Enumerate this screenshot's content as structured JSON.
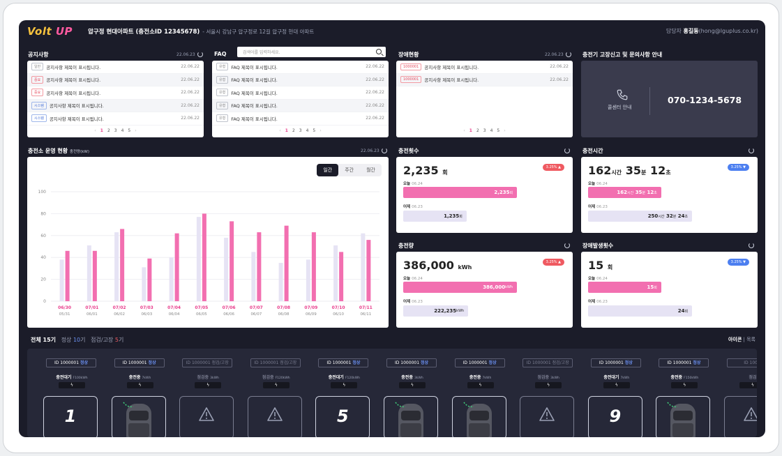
{
  "header": {
    "logo_a": "Volt",
    "logo_b": "UP",
    "site": "압구정 현대아파트 (충전소ID 12345678)",
    "address": "- 서울시 강남구 압구정로 12길 압구정 현대 아파트",
    "user_prefix": "담당자",
    "user_name": "홍길동",
    "user_email": "(hong@lguplus.co.kr)"
  },
  "notice": {
    "title": "공지사항",
    "date": "22.06.23",
    "rows": [
      {
        "badge": "일반",
        "kind": "gray",
        "title": "공지사항 제목이 표시됩니다.",
        "date": "22.06.22"
      },
      {
        "badge": "중요",
        "kind": "red",
        "title": "공지사항 제목이 표시됩니다.",
        "date": "22.06.22"
      },
      {
        "badge": "중요",
        "kind": "red",
        "title": "공지사항 제목이 표시됩니다.",
        "date": "22.06.22"
      },
      {
        "badge": "시스템",
        "kind": "blue",
        "title": "공지사항 제목이 표시됩니다.",
        "date": "22.06.22"
      },
      {
        "badge": "시스템",
        "kind": "blue",
        "title": "공지사항 제목이 표시됩니다.",
        "date": "22.06.22"
      }
    ],
    "pages": [
      "1",
      "2",
      "3",
      "4",
      "5"
    ]
  },
  "faq": {
    "title": "FAQ",
    "search_placeholder": "검색어를 입력하세요.",
    "rows": [
      {
        "badge": "유형",
        "title": "FAQ 제목이 표시됩니다.",
        "date": "22.06.22"
      },
      {
        "badge": "유형",
        "title": "FAQ 제목이 표시됩니다.",
        "date": "22.06.22"
      },
      {
        "badge": "유형",
        "title": "FAQ 제목이 표시됩니다.",
        "date": "22.06.22"
      },
      {
        "badge": "유형",
        "title": "FAQ 제목이 표시됩니다.",
        "date": "22.06.22"
      },
      {
        "badge": "유형",
        "title": "FAQ 제목이 표시됩니다.",
        "date": "22.06.22"
      }
    ],
    "pages": [
      "1",
      "2",
      "3",
      "4",
      "5"
    ]
  },
  "faults": {
    "title": "장애현황",
    "date": "22.06.23",
    "rows": [
      {
        "badge": "1000001",
        "title": "공지사항 제목이 표시됩니다.",
        "date": "22.06.22"
      },
      {
        "badge": "1000001",
        "title": "공지사항 제목이 표시됩니다.",
        "date": "22.06.22"
      }
    ],
    "pages": [
      "1",
      "2",
      "3",
      "4",
      "5"
    ]
  },
  "contact": {
    "title": "충전기 고장신고 및 문의사항 안내",
    "label": "콜센터 안내",
    "number": "070-1234-5678"
  },
  "ops": {
    "title": "충전소 운영 현황",
    "unit": "충전량(kW)",
    "date": "22.06.23",
    "tabs": [
      "일간",
      "주간",
      "월간"
    ]
  },
  "chart_data": {
    "type": "bar",
    "categories": [
      "06/30",
      "07/01",
      "07/02",
      "07/03",
      "07/04",
      "07/05",
      "07/06",
      "07/07",
      "07/08",
      "07/09",
      "07/10",
      "07/11"
    ],
    "categories_prev": [
      "05/31",
      "06/01",
      "06/02",
      "06/03",
      "06/04",
      "06/05",
      "06/06",
      "06/07",
      "06/08",
      "06/09",
      "06/10",
      "06/11"
    ],
    "series": [
      {
        "values": [
          38,
          51,
          63,
          31,
          40,
          77,
          58,
          45,
          35,
          38,
          51,
          62
        ],
        "color": "#e6e3f4"
      },
      {
        "values": [
          46,
          46,
          66,
          39,
          62,
          80,
          73,
          63,
          69,
          63,
          45,
          56
        ],
        "color": "#f26fb0"
      }
    ],
    "yticks": [
      "0",
      "20",
      "40",
      "60",
      "80",
      "100"
    ],
    "ylim": [
      0,
      100
    ]
  },
  "stats": {
    "count": {
      "title": "충전횟수",
      "value": "2,235",
      "unit": "회",
      "badge": "3.25% ▲",
      "today_label": "오늘",
      "today_date": "06.24",
      "today_value": "2,235",
      "today_unit": "회",
      "today_frac": 0.7,
      "yday_label": "어제",
      "yday_date": "06.23",
      "yday_value": "1,235",
      "yday_unit": "회",
      "yday_frac": 0.39
    },
    "time": {
      "title": "충전시간",
      "v1": "162",
      "u1": "시간",
      "v2": "35",
      "u2": "분",
      "v3": "12",
      "u3": "초",
      "badge": "3.25% ▼",
      "today_label": "오늘",
      "today_date": "06.24",
      "today_value": "162",
      "today_u1": "시간",
      "today_v2": "35",
      "today_u2": "분",
      "today_v3": "12",
      "today_u3": "초",
      "today_frac": 0.45,
      "yday_label": "어제",
      "yday_date": "06.23",
      "yday_value": "250",
      "yday_u1": "시간",
      "yday_v2": "32",
      "yday_u2": "분",
      "yday_v3": "24",
      "yday_u3": "초",
      "yday_frac": 0.64
    },
    "energy": {
      "title": "충전량",
      "value": "386,000",
      "unit": "kWh",
      "badge": "3.25% ▲",
      "today_label": "오늘",
      "today_date": "06.24",
      "today_value": "386,000",
      "today_unit": "kWh",
      "today_frac": 0.7,
      "yday_label": "어제",
      "yday_date": "06.23",
      "yday_value": "222,235",
      "yday_unit": "kWh",
      "yday_frac": 0.4
    },
    "fault": {
      "title": "장애발생횟수",
      "value": "15",
      "unit": "회",
      "badge": "3.25% ▼",
      "today_label": "오늘",
      "today_date": "06.24",
      "today_value": "15",
      "today_unit": "회",
      "today_frac": 0.45,
      "yday_label": "어제",
      "yday_date": "06.23",
      "yday_value": "24",
      "yday_unit": "회",
      "yday_frac": 0.64
    }
  },
  "summary": {
    "all_label": "전체",
    "all_count": "15",
    "all_unit": "기",
    "ok_label": "정상",
    "ok_count": "10",
    "ok_unit": "기",
    "fault_label": "점검/고장",
    "fault_count": "5",
    "fault_unit": "기",
    "view_icon": "아이콘",
    "view_sep": "|",
    "view_list": "목록"
  },
  "chargers": [
    {
      "id": "ID 1000001",
      "status": "정상",
      "dim": false,
      "state": "충전대기",
      "power": "F100kWh",
      "kind": "num",
      "num": "1"
    },
    {
      "id": "ID 1000001",
      "status": "정상",
      "dim": false,
      "state": "충전중",
      "power": "7kWh",
      "kind": "car"
    },
    {
      "id": "ID 1000001",
      "status": "점검/고장",
      "dim": true,
      "state": "점검중",
      "power": "3kWh",
      "kind": "warn"
    },
    {
      "id": "ID 1000001",
      "status": "점검/고장",
      "dim": true,
      "state": "점검중",
      "power": "F120kWh",
      "kind": "warn"
    },
    {
      "id": "ID 1000001",
      "status": "정상",
      "dim": false,
      "state": "충전대기",
      "power": "F120kWh",
      "kind": "num",
      "num": "5"
    },
    {
      "id": "ID 1000001",
      "status": "정상",
      "dim": false,
      "state": "충전중",
      "power": "3kWh",
      "kind": "car"
    },
    {
      "id": "ID 1000001",
      "status": "정상",
      "dim": false,
      "state": "충전중",
      "power": "7kWh",
      "kind": "car"
    },
    {
      "id": "ID 1000001",
      "status": "점검/고장",
      "dim": true,
      "state": "점검중",
      "power": "3kWh",
      "kind": "warn"
    },
    {
      "id": "ID 1000001",
      "status": "정상",
      "dim": false,
      "state": "충전대기",
      "power": "7kWh",
      "kind": "num",
      "num": "9"
    },
    {
      "id": "ID 1000001",
      "status": "정상",
      "dim": false,
      "state": "충전중",
      "power": "F150kWh",
      "kind": "car"
    },
    {
      "id": "ID 1000",
      "status": "",
      "dim": true,
      "state": "점검",
      "power": "",
      "kind": "warn"
    }
  ],
  "colors": {
    "accent": "#f26fb0",
    "prev": "#e6e3f4",
    "up": "#ef5a61",
    "down": "#4c7ff0",
    "bg": "#1b1c29"
  }
}
